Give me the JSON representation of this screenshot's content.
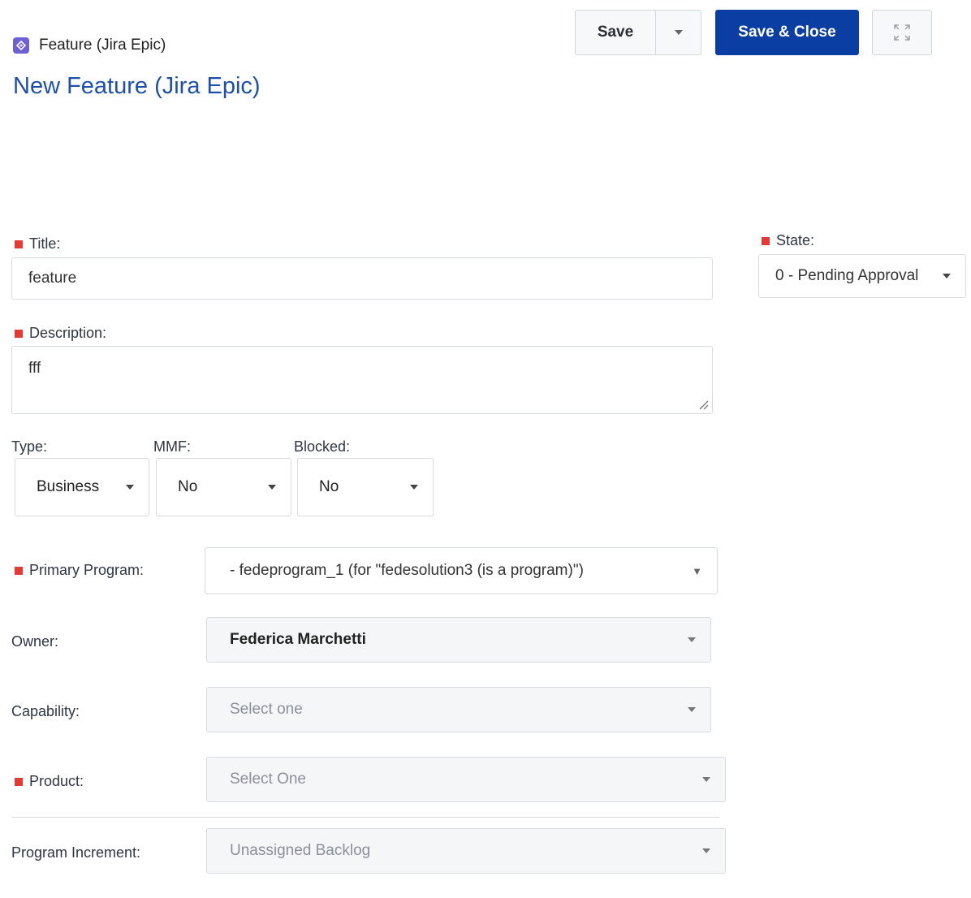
{
  "header": {
    "type_label": "Feature (Jira Epic)",
    "type_icon": "jira-epic-icon",
    "title": "New Feature (Jira Epic)"
  },
  "toolbar": {
    "save_label": "Save",
    "save_close_label": "Save & Close",
    "expand_icon": "expand-icon"
  },
  "form": {
    "title": {
      "label": "Title:",
      "value": "feature"
    },
    "state": {
      "label": "State:",
      "value": "0 - Pending Approval"
    },
    "description": {
      "label": "Description:",
      "value": "fff"
    },
    "type": {
      "label": "Type:",
      "value": "Business"
    },
    "mmf": {
      "label": "MMF:",
      "value": "No"
    },
    "blocked": {
      "label": "Blocked:",
      "value": "No"
    },
    "primary_program": {
      "label": "Primary Program:",
      "value": "- fedeprogram_1 (for \"fedesolution3 (is a program)\")"
    },
    "owner": {
      "label": "Owner:",
      "value": "Federica Marchetti"
    },
    "capability": {
      "label": "Capability:",
      "placeholder": "Select one"
    },
    "product": {
      "label": "Product:",
      "placeholder": "Select One"
    },
    "program_increment": {
      "label": "Program Increment:",
      "value": "Unassigned Backlog"
    }
  },
  "colors": {
    "accent": "#0b3ea3",
    "title": "#1d4fae",
    "required": "#e53935",
    "type_icon": "#6f5fd6"
  }
}
